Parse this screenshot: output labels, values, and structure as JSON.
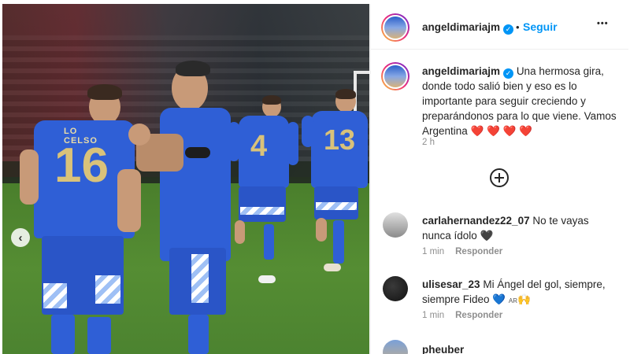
{
  "post": {
    "username": "angeldimariajm",
    "follow_label": "Seguir",
    "separator": "•",
    "more_label": "•••",
    "caption": {
      "username": "angeldimariajm",
      "text": "Una hermosa gira, donde todo salió bien y eso es lo importante para seguir creciendo y preparándonos para lo que viene. Vamos Argentina",
      "hearts": "❤️ ❤️ ❤️ ❤️",
      "time": "2 h"
    },
    "photo": {
      "player1_name": "LO CELSO",
      "player1_number": "16",
      "player3_number": "4",
      "player4_number": "13"
    }
  },
  "comments": [
    {
      "username": "carlahernandez22_07",
      "text": "No te vayas nunca ídolo",
      "suffix": "🖤",
      "time": "1 min",
      "reply_label": "Responder"
    },
    {
      "username": "ulisesar_23",
      "text": "Mi Ángel del gol, siempre, siempre Fideo",
      "suffix_heart": "💙",
      "suffix_flag": "AR",
      "suffix_hands": "🙌",
      "time": "1 min",
      "reply_label": "Responder"
    },
    {
      "username": "pheuber"
    }
  ],
  "colors": {
    "link_blue": "#0095f6",
    "text": "#262626",
    "muted": "#8e8e8e",
    "kit_blue": "#2f5fd6"
  },
  "icons": {
    "verified": "verified-badge-icon",
    "more": "more-options-icon",
    "prev": "chevron-left-icon",
    "add": "add-circle-icon"
  }
}
